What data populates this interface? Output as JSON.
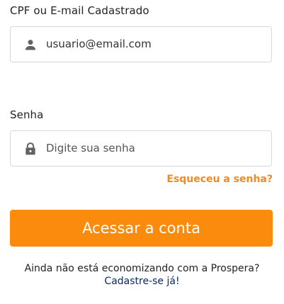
{
  "login": {
    "email_label": "CPF ou E-mail Cadastrado",
    "email_value": "usuario@email.com",
    "password_label": "Senha",
    "password_placeholder": "Digite sua senha",
    "forgot_password": "Esqueceu a senha?",
    "submit_label": "Acessar a conta",
    "signup_prompt": "Ainda não está economizando com a Prospera?",
    "signup_link": "Cadastre-se já!"
  },
  "icons": {
    "email_field": "user-icon",
    "password_field": "lock-icon"
  },
  "colors": {
    "accent": "#fb8b0c",
    "forgot_link": "#f28a1c",
    "signup_link": "#0a2a63",
    "icon": "#5f6368",
    "border": "#d7d7d7"
  }
}
